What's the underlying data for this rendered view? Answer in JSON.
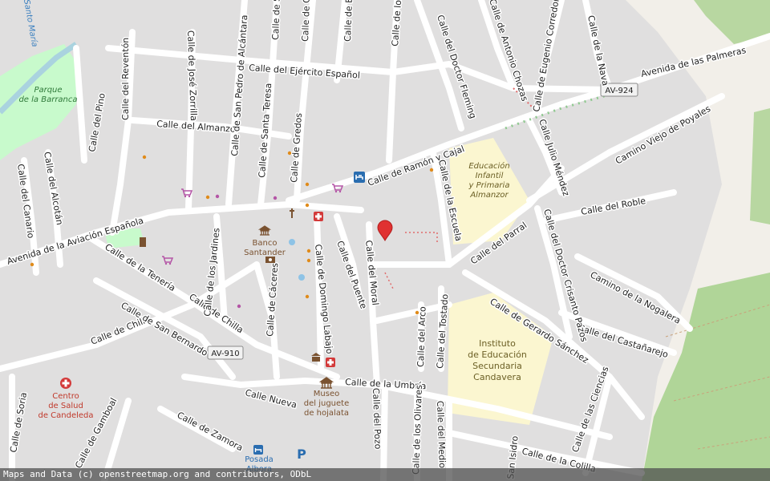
{
  "colors": {
    "land": "#f2efe9",
    "block": "#e0dfdf",
    "street": "#ffffff",
    "street_casing": "#c8c8c8",
    "park": "#c8facc",
    "forest": "#a9d18f",
    "water": "#aad3df",
    "school_area": "#fbf6d0",
    "marker": "#e03131",
    "poi_orange": "#e08b1a",
    "poi_purple": "#b455a6",
    "attribution_bg": "#555555"
  },
  "streets": {
    "calle_del_ejercito_espanol": "Calle del Ejército Español",
    "avenida_de_las_palmeras": "Avenida de las Palmeras",
    "calle_del_almanzor": "Calle del Almanzor",
    "calle_de_ramon_y_cajal": "Calle de Ramón y Cajal",
    "avenida_aviacion_espanola": "Avenida de la Aviación Española",
    "calle_del_roble": "Calle del Roble",
    "camino_viejo_de_poyales": "Camino Viejo de Poyales",
    "calle_del_parral": "Calle del Parral",
    "calle_de_gerardo_sanchez": "Calle de Gerardo Sánchez",
    "calle_de_la_umbria": "Calle de la Umbría",
    "calle_nueva": "Calle Nueva",
    "calle_de_chilla_1": "Calle de Chilla",
    "calle_de_chilla_2": "Calle de Chilla",
    "calle_de_la_teneria": "Calle de la Tenería",
    "calle_de_san_bernardo": "Calle de San Bernardo",
    "camino_de_la_nogalera": "Camino de la Nogalera",
    "calle_del_castanarejo": "Calle del Castañarejo",
    "calle_de_las_ciencias": "Calle de las Ciencias",
    "calle_de_la_colilla": "Calle de la Colilla",
    "calle_del_pino": "Calle del Pino",
    "calle_del_reventon": "Calle del Reventón",
    "calle_de_jose_zorrilla": "Calle de José Zorrilla",
    "calle_de_san_pedro_de_alcantara": "Calle de San Pedro de Alcántara",
    "calle_de_santa_teresa": "Calle de Santa Teresa",
    "calle_de_gredos": "Calle de Gredos",
    "calle_del_doctor_fleming": "Calle del Doctor Fleming",
    "calle_de_antonio_chozas": "Calle de Antonio Chozas",
    "calle_de_eugenio_corredor": "Calle de Eugenio Corredor",
    "calle_de_la_nava": "Calle de la Nava",
    "calle_julio_mendez": "Calle Julio Méndez",
    "calle_del_doctor_crisanto_pazos": "Calle del Doctor Crisanto Pazos",
    "calle_de_la_escuela": "Calle de la Escuela",
    "calle_del_moral": "Calle del Moral",
    "calle_del_puente": "Calle del Puente",
    "calle_de_domingo_labajo": "Calle de Domingo Labajo",
    "calle_de_caceres": "Calle de Cáceres",
    "calle_de_los_jardines": "Calle de los Jardines",
    "calle_del_alcotan": "Calle del Alcotán",
    "calle_del_canario": "Calle del Canario",
    "calle_del_arco": "Calle del Arco",
    "calle_del_tostado": "Calle del Tostado",
    "calle_del_pozo": "Calle del Pozo",
    "calle_de_los_olivares": "Calle de los Olivares",
    "calle_del_medio": "Calle del Medio",
    "calle_de_soria": "Calle de Soria",
    "calle_de_gamboal": "Calle de Gamboal",
    "calle_de_zamora": "Calle de Zamora",
    "calle_de_benavente_cut": "Calle de Benave",
    "calle_de_gredos_top_cut": "Calle de G",
    "calle_de_san_cut": "Calle de Sa",
    "calle_de_los_cut": "Calle de los",
    "san_isidro_cut": "San Isidro",
    "santo_maria_cut": "Santo María"
  },
  "shields": {
    "av_924": "AV-924",
    "av_910": "AV-910"
  },
  "places": {
    "parque_line1": "Parque",
    "parque_line2": "de la Barranca",
    "school_line1": "Educación",
    "school_line2": "Infantil",
    "school_line3": "y Primaria",
    "school_line4": "Almanzor",
    "instituto_line1": "Instituto",
    "instituto_line2": "de Educación",
    "instituto_line3": "Secundaria",
    "instituto_line4": "Candavera",
    "banco_line1": "Banco",
    "banco_line2": "Santander",
    "museo_line1": "Museo",
    "museo_line2": "del juguete",
    "museo_line3": "de hojalata",
    "centro_line1": "Centro",
    "centro_line2": "de Salud",
    "centro_line3": "de Candeleda",
    "posada_line1": "Posada",
    "posada_line2": "Albora"
  },
  "icons": {
    "pin": "location-pin-icon",
    "pharmacy": "pharmacy-icon",
    "shop": "shopping-cart-icon",
    "bank": "bank-icon",
    "museum": "museum-icon",
    "parking": "parking-icon",
    "hotel": "hotel-icon",
    "clinic": "clinic-icon"
  },
  "parking_letter": "P",
  "attribution": "Maps and Data (c) openstreetmap.org and contributors, ODbL"
}
